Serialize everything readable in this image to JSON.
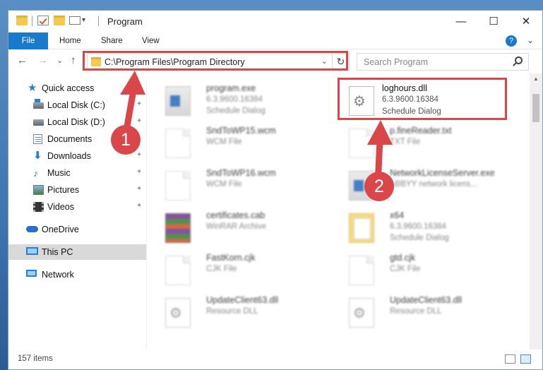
{
  "window": {
    "title": "Program",
    "minimize_glyph": "—",
    "maximize_glyph": "☐",
    "close_glyph": "✕"
  },
  "ribbon": {
    "tabs": [
      "File",
      "Home",
      "Share",
      "View"
    ],
    "collapse_glyph": "⌄",
    "help_glyph": "?"
  },
  "navbar": {
    "back_glyph": "←",
    "forward_glyph": "→",
    "recent_glyph": "⌄",
    "up_glyph": "↑",
    "address": "C:\\Program Files\\Program Directory",
    "address_drop_glyph": "⌄",
    "refresh_glyph": "↻",
    "search_placeholder": "Search Program"
  },
  "sidebar": {
    "items": [
      {
        "label": "Quick access",
        "icon": "star-icon"
      },
      {
        "label": "Local Disk (C:)",
        "icon": "disk-icon"
      },
      {
        "label": "Local Disk (D:)",
        "icon": "disk-icon"
      },
      {
        "label": "Documents",
        "icon": "documents-icon"
      },
      {
        "label": "Downloads",
        "icon": "downloads-icon"
      },
      {
        "label": "Music",
        "icon": "music-icon"
      },
      {
        "label": "Pictures",
        "icon": "pictures-icon"
      },
      {
        "label": "Videos",
        "icon": "videos-icon"
      },
      {
        "label": "OneDrive",
        "icon": "cloud-icon"
      },
      {
        "label": "This PC",
        "icon": "computer-icon"
      },
      {
        "label": "Network",
        "icon": "network-icon"
      }
    ],
    "pin_glyph": "📌"
  },
  "files": {
    "left": [
      {
        "name": "program.exe",
        "line1": "6.3.9600.16384",
        "line2": "Schedule Dialog"
      },
      {
        "name": "SndToWP15.wcm",
        "line1": "WCM File",
        "line2": ""
      },
      {
        "name": "SndToWP16.wcm",
        "line1": "WCM File",
        "line2": ""
      },
      {
        "name": "certificates.cab",
        "line1": "WinRAR Archive",
        "line2": ""
      },
      {
        "name": "FastKorn.cjk",
        "line1": "CJK File",
        "line2": ""
      },
      {
        "name": "UpdateClient63.dll",
        "line1": "Resource DLL",
        "line2": ""
      }
    ],
    "right": [
      {
        "name": "loghours.dll",
        "line1": "6.3.9600.16384",
        "line2": "Schedule Dialog"
      },
      {
        "name": "p.fineReader.txt",
        "line1": "TXT File",
        "line2": ""
      },
      {
        "name": "NetworkLicenseServer.exe",
        "line1": "ABBYY network licens...",
        "line2": ""
      },
      {
        "name": "x64",
        "line1": "6.3.9600.16384",
        "line2": "Schedule Dialog"
      },
      {
        "name": "gtd.cjk",
        "line1": "CJK File",
        "line2": ""
      },
      {
        "name": "UpdateClient63.dll",
        "line1": "Resource DLL",
        "line2": ""
      }
    ]
  },
  "status": {
    "item_count": "157 items"
  },
  "annotations": {
    "badge1": "1",
    "badge2": "2",
    "color": "#d9474a"
  }
}
